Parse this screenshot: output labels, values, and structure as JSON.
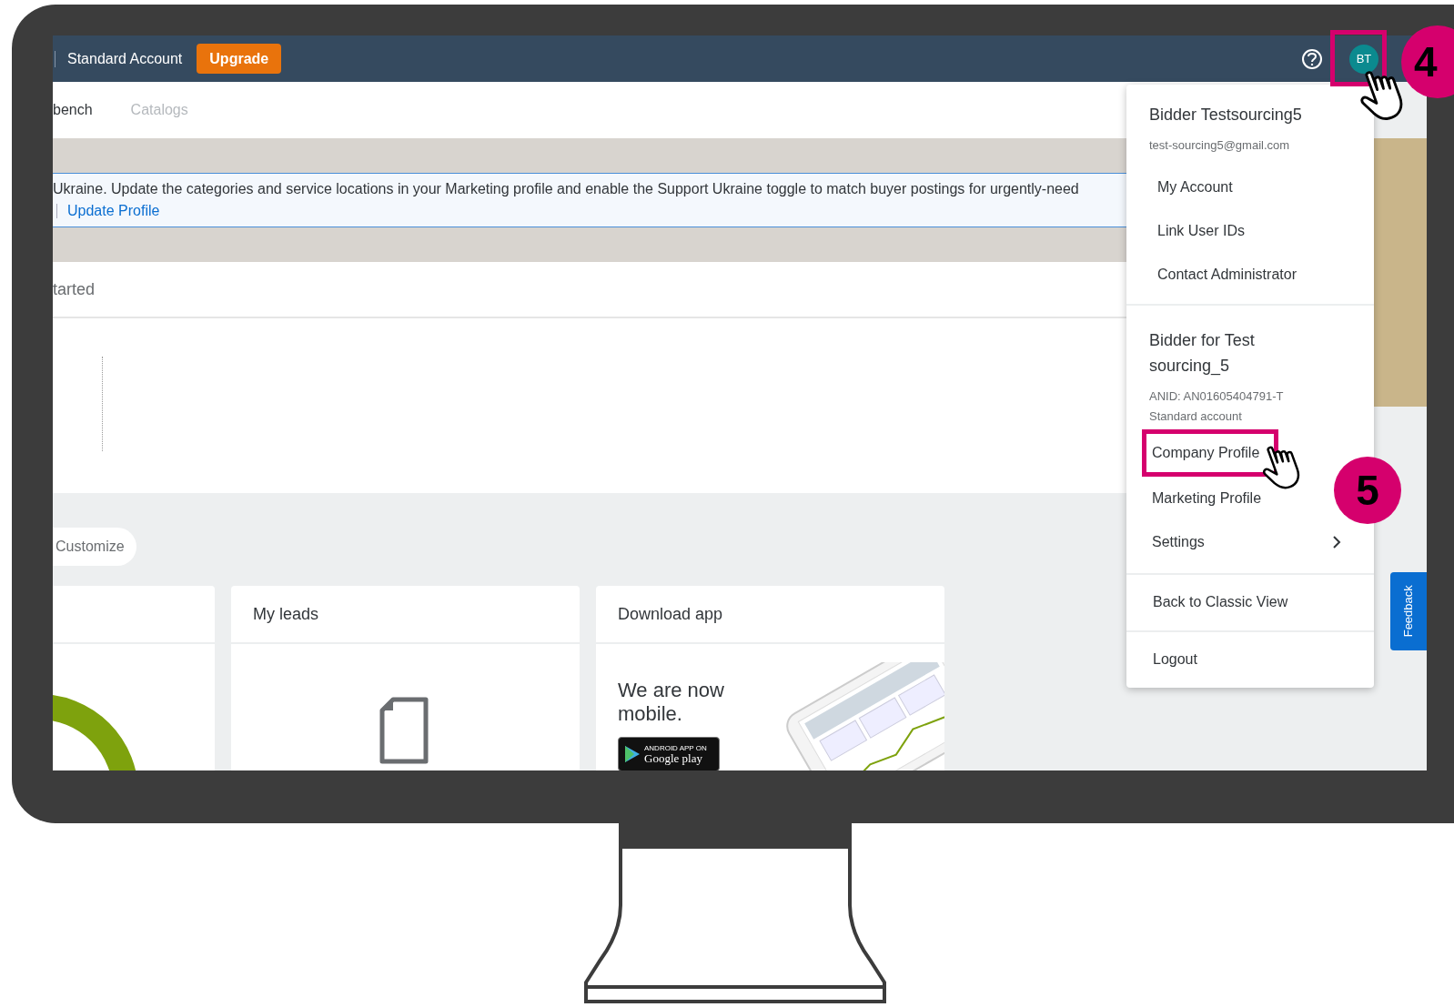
{
  "top_bar": {
    "account_type": "Standard Account",
    "upgrade_button": "Upgrade",
    "avatar": {
      "initials": "BT",
      "highlighted": true,
      "step": "4"
    }
  },
  "tabs": [
    {
      "label": "bench",
      "disabled": false
    },
    {
      "label": "Catalogs",
      "disabled": true
    }
  ],
  "banner": {
    "message": "Ukraine. Update the categories and service locations in your Marketing profile and enable the Support Ukraine toggle to match buyer postings for urgently-need",
    "link": "Update Profile"
  },
  "section_title": "tarted",
  "customize_button": "Customize",
  "cards": [
    {
      "kind": "donut"
    },
    {
      "kind": "empty",
      "title": "My leads"
    },
    {
      "kind": "app",
      "title": "Download app",
      "text": "We are now mobile.",
      "store_small": "ANDROID APP ON",
      "store": "Google play"
    }
  ],
  "user_menu": {
    "name": "Bidder Testsourcing5",
    "email": "test-sourcing5@gmail.com",
    "user_items": [
      {
        "label": "My Account",
        "highlighted": false
      },
      {
        "label": "Link User IDs",
        "highlighted": false
      },
      {
        "label": "Contact Administrator",
        "highlighted": false
      }
    ],
    "org_name": "Bidder for Test sourcing_5",
    "anid": "ANID: AN01605404791-T",
    "account": "Standard account",
    "org_items": [
      {
        "label": "Company Profile",
        "highlighted": true,
        "submenu": false,
        "step": "5"
      },
      {
        "label": "Marketing Profile",
        "highlighted": false,
        "submenu": false
      },
      {
        "label": "Settings",
        "highlighted": false,
        "submenu": true
      }
    ],
    "footer_items": [
      "Back to Classic View",
      "Logout"
    ]
  },
  "feedback_tab": "Feedback"
}
